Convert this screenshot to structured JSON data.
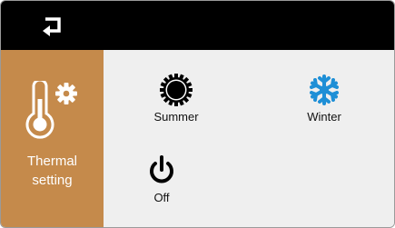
{
  "header": {
    "back_icon": "back-arrow-icon"
  },
  "sidebar": {
    "active_item": {
      "label_line1": "Thermal",
      "label_line2": "setting",
      "icons": [
        "thermometer-icon",
        "gear-icon"
      ],
      "background_color": "#c58a4b"
    }
  },
  "modes": [
    {
      "label": "Summer",
      "icon": "sun-icon"
    },
    {
      "label": "Winter",
      "icon": "snowflake-icon",
      "icon_color": "#1e8fd6"
    },
    {
      "label": "Off",
      "icon": "power-icon"
    }
  ]
}
